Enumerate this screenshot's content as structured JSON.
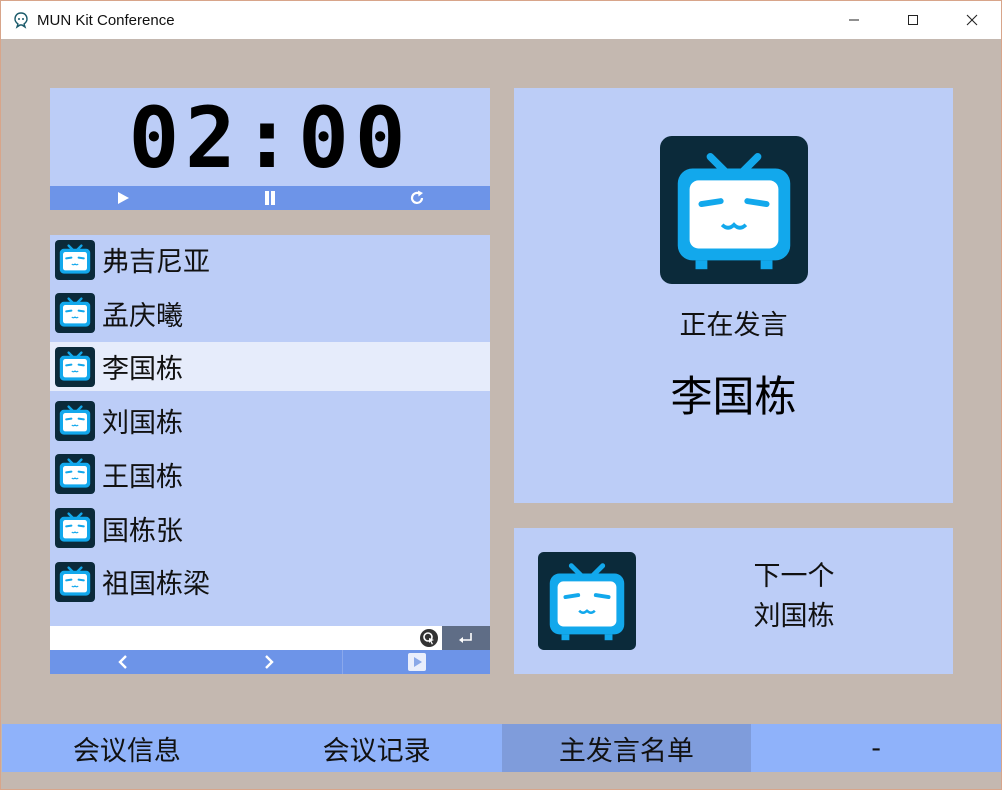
{
  "window": {
    "title": "MUN Kit Conference",
    "minimize": "—",
    "maximize": "☐",
    "close": "✕"
  },
  "timer": {
    "time": "02:00",
    "controls": [
      "play-icon",
      "pause-icon",
      "reset-icon"
    ]
  },
  "speakers": {
    "items": [
      {
        "name": "弗吉尼亚",
        "selected": false
      },
      {
        "name": "孟庆曦",
        "selected": false
      },
      {
        "name": "李国栋",
        "selected": true
      },
      {
        "name": "刘国栋",
        "selected": false
      },
      {
        "name": "王国栋",
        "selected": false
      },
      {
        "name": "国栋张",
        "selected": false
      },
      {
        "name": "祖国栋梁",
        "selected": false
      }
    ],
    "input_value": "",
    "input_placeholder": ""
  },
  "current": {
    "label": "正在发言",
    "name": "李国栋"
  },
  "next": {
    "label": "下一个",
    "name": "刘国栋"
  },
  "tabs": [
    {
      "label": "会议信息",
      "active": false
    },
    {
      "label": "会议记录",
      "active": false
    },
    {
      "label": "主发言名单",
      "active": true
    },
    {
      "label": "-",
      "active": false
    }
  ],
  "colors": {
    "panel": "#bccdf7",
    "accent": "#6d94e8",
    "avatar_bg": "#0b2a3a",
    "avatar_tv": "#12a8ec"
  }
}
